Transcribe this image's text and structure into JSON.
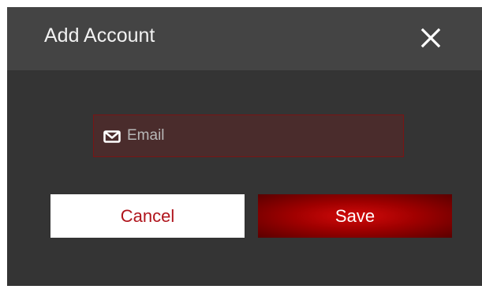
{
  "dialog": {
    "title": "Add Account",
    "close_icon": "close-icon"
  },
  "form": {
    "email": {
      "icon": "mail-icon",
      "placeholder": "Email",
      "value": ""
    }
  },
  "actions": {
    "cancel_label": "Cancel",
    "save_label": "Save"
  },
  "colors": {
    "dialog_bg": "#343434",
    "header_bg": "#444444",
    "accent": "#b0141c",
    "field_bg": "#4a2c2c"
  }
}
